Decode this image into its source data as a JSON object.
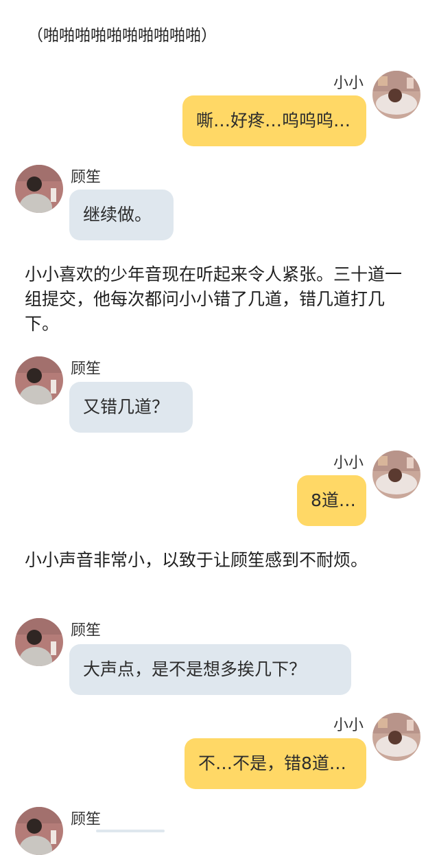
{
  "sound_effect": "（啪啪啪啪啪啪啪啪啪啪）",
  "characters": {
    "xiaoxiao": {
      "name": "小小",
      "avatar_icon": "xiaoxiao-avatar-icon"
    },
    "guzheng": {
      "name": "顾笙",
      "avatar_icon": "guzheng-avatar-icon"
    }
  },
  "messages": [
    {
      "sender": "小小",
      "side": "right",
      "text": "嘶…好疼…呜呜呜…"
    },
    {
      "sender": "顾笙",
      "side": "left",
      "text": "继续做。"
    },
    {
      "narration": "小小喜欢的少年音现在听起来令人紧张。三十道一组提交，他每次都问小小错了几道，错几道打几下。"
    },
    {
      "sender": "顾笙",
      "side": "left",
      "text": "又错几道？"
    },
    {
      "sender": "小小",
      "side": "right",
      "text": "8道…"
    },
    {
      "narration": "小小声音非常小，以致于让顾笙感到不耐烦。"
    },
    {
      "sender": "顾笙",
      "side": "left",
      "text": "大声点，是不是想多挨几下？"
    },
    {
      "sender": "小小",
      "side": "right",
      "text": "不…不是，错8道…"
    },
    {
      "sender": "顾笙",
      "side": "left",
      "text": ""
    }
  ],
  "colors": {
    "left_bubble": "#dfe7ee",
    "right_bubble": "#ffd866",
    "background": "#ffffff"
  }
}
